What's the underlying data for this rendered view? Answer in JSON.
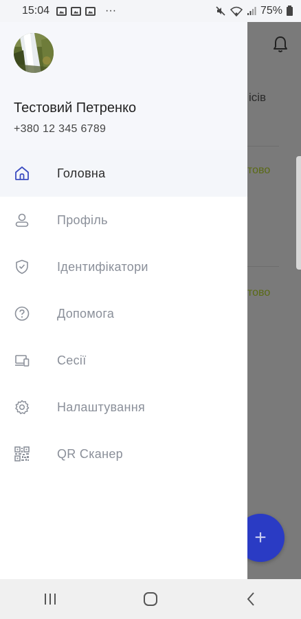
{
  "status_bar": {
    "time": "15:04",
    "dots": "···",
    "battery_percent": "75%"
  },
  "drawer": {
    "user": {
      "name": "Тестовий Петренко",
      "phone": "+380 12 345 6789"
    },
    "menu": [
      {
        "label": "Головна",
        "icon": "home-icon",
        "active": true
      },
      {
        "label": "Профіль",
        "icon": "user-icon",
        "active": false
      },
      {
        "label": "Ідентифікатори",
        "icon": "shield-check-icon",
        "active": false
      },
      {
        "label": "Допомога",
        "icon": "help-circle-icon",
        "active": false
      },
      {
        "label": "Сесії",
        "icon": "devices-icon",
        "active": false
      },
      {
        "label": "Налаштування",
        "icon": "gear-icon",
        "active": false
      },
      {
        "label": "QR Сканер",
        "icon": "qr-code-icon",
        "active": false
      }
    ]
  },
  "background": {
    "partial_text_1": "ісів",
    "partial_status_1": "тово",
    "partial_status_2": "тово",
    "fab_label": "+"
  },
  "colors": {
    "accent": "#2a3bc4",
    "active_icon": "#3b4cc0",
    "inactive_text": "#8a8f99",
    "status_green": "#5a6a14"
  }
}
